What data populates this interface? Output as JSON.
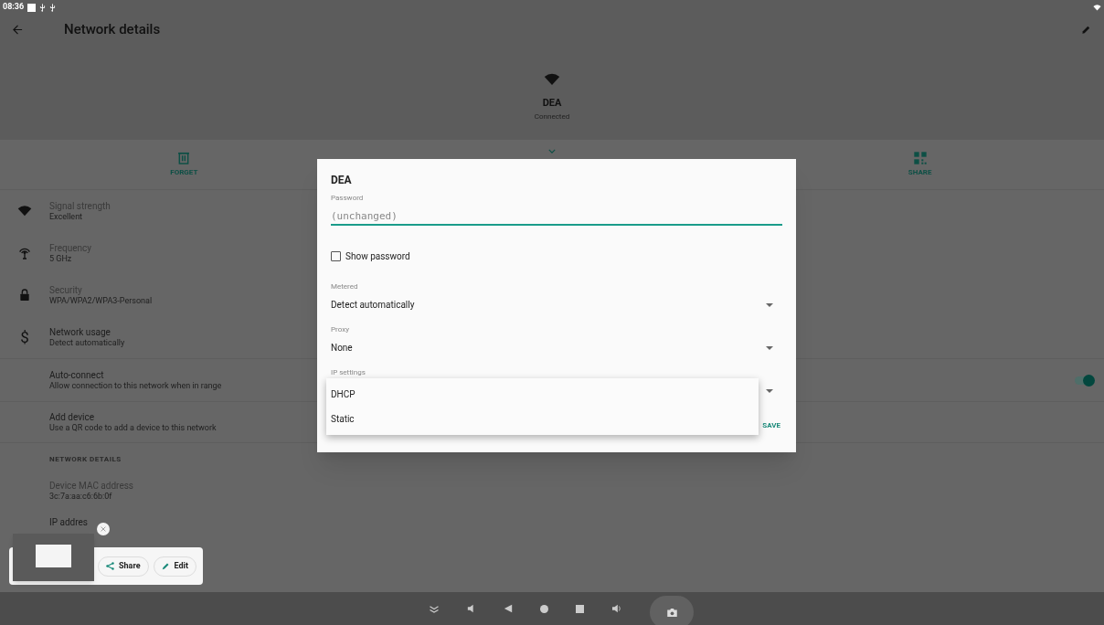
{
  "status_bar": {
    "time": "08:36"
  },
  "app_bar": {
    "title": "Network details"
  },
  "network": {
    "name": "DEA",
    "status": "Connected"
  },
  "actions": [
    {
      "label": "FORGET",
      "kind": "trash"
    },
    {
      "label": "SHARE",
      "kind": "qr"
    }
  ],
  "details": [
    {
      "title": "Signal strength",
      "value": "Excellent",
      "kind": "wifi"
    },
    {
      "title": "Frequency",
      "value": "5 GHz",
      "kind": "antenna"
    },
    {
      "title": "Security",
      "value": "WPA/WPA2/WPA3-Personal",
      "kind": "lock"
    },
    {
      "title": "Network usage",
      "value": "Detect automatically",
      "kind": "text",
      "icon": "$"
    }
  ],
  "auto_connect": {
    "title": "Auto-connect",
    "subtitle": "Allow connection to this network when in range",
    "on": true
  },
  "add_device": {
    "title": "Add device",
    "subtitle": "Use a QR code to add a device to this network"
  },
  "network_details": {
    "heading": "NETWORK DETAILS",
    "mac_label": "Device MAC address",
    "mac_value": "3c:7a:aa:c6:6b:0f",
    "ip_label": "IP addres"
  },
  "dialog": {
    "title": "DEA",
    "password_label": "Password",
    "password_placeholder": "(unchanged)",
    "show_password": {
      "label": "Show password",
      "checked": false
    },
    "metered": {
      "label": "Metered",
      "value": "Detect automatically"
    },
    "proxy": {
      "label": "Proxy",
      "value": "None"
    },
    "ip_settings": {
      "label": "IP settings"
    },
    "buttons": [
      "SAVE"
    ],
    "menu": [
      {
        "label": "DHCP"
      },
      {
        "label": "Static"
      }
    ]
  },
  "screenshot_toast": {
    "buttons": [
      {
        "label": "Share",
        "kind": "share"
      },
      {
        "label": "Edit",
        "kind": "edit"
      }
    ]
  }
}
